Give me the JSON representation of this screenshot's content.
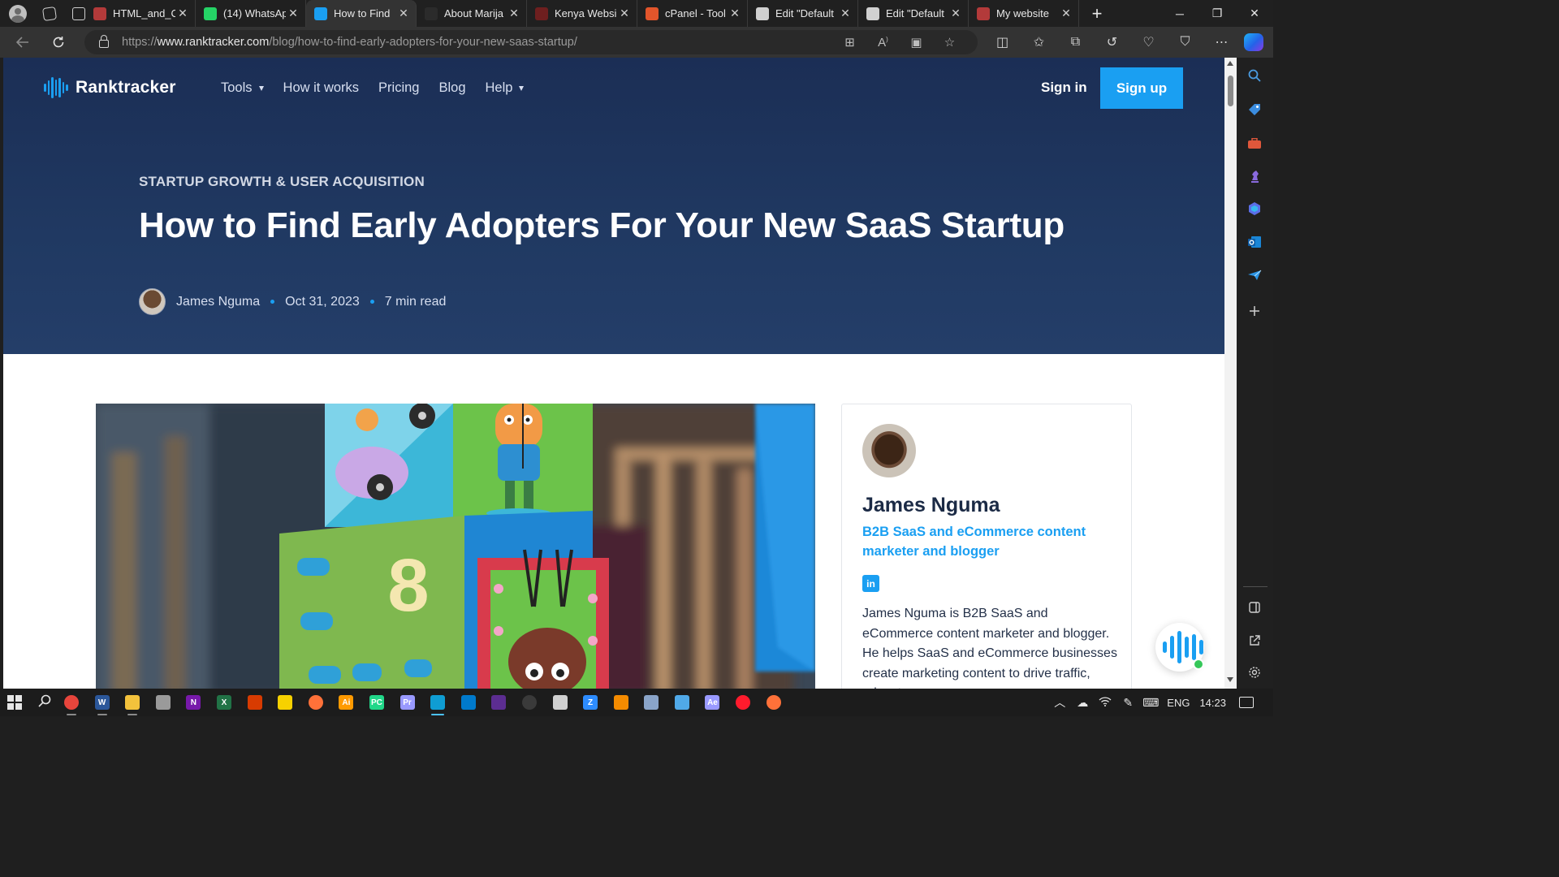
{
  "browser": {
    "tabs": [
      {
        "title": "HTML_and_C",
        "favicon_color": "#b33a3a",
        "active": false
      },
      {
        "title": "(14) WhatsAp",
        "favicon_color": "#25d366",
        "active": false
      },
      {
        "title": "How to Find",
        "favicon_color": "#1a9ff2",
        "active": true
      },
      {
        "title": "About Marija",
        "favicon_color": "#2b2b2b",
        "active": false
      },
      {
        "title": "Kenya Websi",
        "favicon_color": "#6e1f1f",
        "active": false
      },
      {
        "title": "cPanel - Tool",
        "favicon_color": "#e2552b",
        "active": false
      },
      {
        "title": "Edit \"Default",
        "favicon_color": "#d0d0d0",
        "active": false
      },
      {
        "title": "Edit \"Default",
        "favicon_color": "#d0d0d0",
        "active": false
      },
      {
        "title": "My website",
        "favicon_color": "#b33a3a",
        "active": false
      }
    ],
    "tab_close_glyph": "✕",
    "new_tab_glyph": "+",
    "window_controls": [
      "─",
      "❐",
      "✕"
    ],
    "url_scheme": "https://",
    "url_domain": "www.ranktracker.com",
    "url_path": "/blog/how-to-find-early-adopters-for-your-new-saas-startup/",
    "omnibox_icons": [
      "apps-icon",
      "read-aloud-icon",
      "immersive-reader-icon",
      "favorite-star-icon"
    ],
    "toolbar_icons": [
      "split-screen-icon",
      "favorites-icon",
      "collections-icon",
      "history-icon",
      "performance-icon",
      "browser-essentials-icon",
      "more-menu-icon"
    ],
    "accent": "#0078d4"
  },
  "site": {
    "brand": "Ranktracker",
    "nav": [
      {
        "label": "Tools",
        "dropdown": true
      },
      {
        "label": "How it works",
        "dropdown": false
      },
      {
        "label": "Pricing",
        "dropdown": false
      },
      {
        "label": "Blog",
        "dropdown": false
      },
      {
        "label": "Help",
        "dropdown": true
      }
    ],
    "signin": "Sign in",
    "signup": "Sign up",
    "colors": {
      "hero_bg": "#1f355e",
      "accent": "#1a9ff2",
      "heading": "#1b2a45"
    }
  },
  "article": {
    "category": "STARTUP GROWTH & USER ACQUISITION",
    "title": "How to Find Early Adopters For Your New SaaS Startup",
    "author": "James Nguma",
    "date": "Oct 31, 2023",
    "read_time": "7 min read"
  },
  "author_card": {
    "name": "James Nguma",
    "role": "B2B SaaS and eCommerce content marketer and blogger",
    "social_icon": "linkedin-icon",
    "bio": "James Nguma is B2B SaaS and eCommerce content marketer and blogger. He helps SaaS and eCommerce businesses create marketing content to drive traffic, educate"
  },
  "feature_image": {
    "subject": "toy-blocks-photo",
    "visible_digit": "8"
  },
  "taskbar": {
    "apps": [
      {
        "name": "chrome",
        "color": "#e8453c",
        "label": "",
        "running": true
      },
      {
        "name": "word",
        "color": "#2b579a",
        "label": "W",
        "running": true
      },
      {
        "name": "file-explorer",
        "color": "#f3c23c",
        "label": "",
        "running": true
      },
      {
        "name": "usb-device",
        "color": "#9a9a9a",
        "label": "",
        "running": false
      },
      {
        "name": "onenote",
        "color": "#7719aa",
        "label": "N",
        "running": false
      },
      {
        "name": "excel",
        "color": "#217346",
        "label": "X",
        "running": false
      },
      {
        "name": "office",
        "color": "#d83b01",
        "label": "",
        "running": false
      },
      {
        "name": "sticky-notes",
        "color": "#f7d100",
        "label": "",
        "running": false
      },
      {
        "name": "firefox",
        "color": "#ff7139",
        "label": "",
        "running": false
      },
      {
        "name": "illustrator",
        "color": "#ff9a00",
        "label": "Ai",
        "running": false
      },
      {
        "name": "pycharm",
        "color": "#21d789",
        "label": "PC",
        "running": false
      },
      {
        "name": "premiere",
        "color": "#9999ff",
        "label": "Pr",
        "running": false
      },
      {
        "name": "edge",
        "color": "#0f9dd3",
        "label": "",
        "running": true,
        "active": true
      },
      {
        "name": "vscode",
        "color": "#007acc",
        "label": "",
        "running": false
      },
      {
        "name": "visual-studio",
        "color": "#5c2d91",
        "label": "",
        "running": false
      },
      {
        "name": "obs",
        "color": "#3a3a3a",
        "label": "",
        "running": false
      },
      {
        "name": "windows-window",
        "color": "#d0d0d0",
        "label": "",
        "running": false
      },
      {
        "name": "zoom",
        "color": "#2d8cff",
        "label": "Z",
        "running": false
      },
      {
        "name": "vlc",
        "color": "#f48b00",
        "label": "",
        "running": false
      },
      {
        "name": "network-printer",
        "color": "#8aa4c8",
        "label": "",
        "running": false
      },
      {
        "name": "windows-store",
        "color": "#50a9e8",
        "label": "",
        "running": false
      },
      {
        "name": "after-effects",
        "color": "#9999ff",
        "label": "Ae",
        "running": false
      },
      {
        "name": "opera",
        "color": "#ff1b2d",
        "label": "",
        "running": false
      },
      {
        "name": "firefox-dev",
        "color": "#ff7139",
        "label": "",
        "running": false
      }
    ],
    "lang": "ENG",
    "time": "14:23"
  }
}
